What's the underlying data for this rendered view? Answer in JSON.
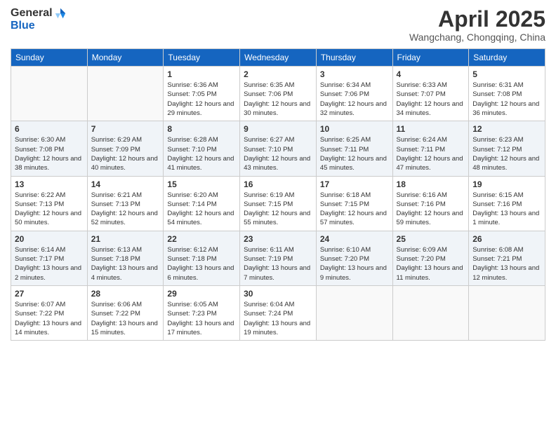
{
  "logo": {
    "general": "General",
    "blue": "Blue"
  },
  "title": "April 2025",
  "location": "Wangchang, Chongqing, China",
  "days_of_week": [
    "Sunday",
    "Monday",
    "Tuesday",
    "Wednesday",
    "Thursday",
    "Friday",
    "Saturday"
  ],
  "weeks": [
    [
      {
        "day": "",
        "sunrise": "",
        "sunset": "",
        "daylight": ""
      },
      {
        "day": "",
        "sunrise": "",
        "sunset": "",
        "daylight": ""
      },
      {
        "day": "1",
        "sunrise": "Sunrise: 6:36 AM",
        "sunset": "Sunset: 7:05 PM",
        "daylight": "Daylight: 12 hours and 29 minutes."
      },
      {
        "day": "2",
        "sunrise": "Sunrise: 6:35 AM",
        "sunset": "Sunset: 7:06 PM",
        "daylight": "Daylight: 12 hours and 30 minutes."
      },
      {
        "day": "3",
        "sunrise": "Sunrise: 6:34 AM",
        "sunset": "Sunset: 7:06 PM",
        "daylight": "Daylight: 12 hours and 32 minutes."
      },
      {
        "day": "4",
        "sunrise": "Sunrise: 6:33 AM",
        "sunset": "Sunset: 7:07 PM",
        "daylight": "Daylight: 12 hours and 34 minutes."
      },
      {
        "day": "5",
        "sunrise": "Sunrise: 6:31 AM",
        "sunset": "Sunset: 7:08 PM",
        "daylight": "Daylight: 12 hours and 36 minutes."
      }
    ],
    [
      {
        "day": "6",
        "sunrise": "Sunrise: 6:30 AM",
        "sunset": "Sunset: 7:08 PM",
        "daylight": "Daylight: 12 hours and 38 minutes."
      },
      {
        "day": "7",
        "sunrise": "Sunrise: 6:29 AM",
        "sunset": "Sunset: 7:09 PM",
        "daylight": "Daylight: 12 hours and 40 minutes."
      },
      {
        "day": "8",
        "sunrise": "Sunrise: 6:28 AM",
        "sunset": "Sunset: 7:10 PM",
        "daylight": "Daylight: 12 hours and 41 minutes."
      },
      {
        "day": "9",
        "sunrise": "Sunrise: 6:27 AM",
        "sunset": "Sunset: 7:10 PM",
        "daylight": "Daylight: 12 hours and 43 minutes."
      },
      {
        "day": "10",
        "sunrise": "Sunrise: 6:25 AM",
        "sunset": "Sunset: 7:11 PM",
        "daylight": "Daylight: 12 hours and 45 minutes."
      },
      {
        "day": "11",
        "sunrise": "Sunrise: 6:24 AM",
        "sunset": "Sunset: 7:11 PM",
        "daylight": "Daylight: 12 hours and 47 minutes."
      },
      {
        "day": "12",
        "sunrise": "Sunrise: 6:23 AM",
        "sunset": "Sunset: 7:12 PM",
        "daylight": "Daylight: 12 hours and 48 minutes."
      }
    ],
    [
      {
        "day": "13",
        "sunrise": "Sunrise: 6:22 AM",
        "sunset": "Sunset: 7:13 PM",
        "daylight": "Daylight: 12 hours and 50 minutes."
      },
      {
        "day": "14",
        "sunrise": "Sunrise: 6:21 AM",
        "sunset": "Sunset: 7:13 PM",
        "daylight": "Daylight: 12 hours and 52 minutes."
      },
      {
        "day": "15",
        "sunrise": "Sunrise: 6:20 AM",
        "sunset": "Sunset: 7:14 PM",
        "daylight": "Daylight: 12 hours and 54 minutes."
      },
      {
        "day": "16",
        "sunrise": "Sunrise: 6:19 AM",
        "sunset": "Sunset: 7:15 PM",
        "daylight": "Daylight: 12 hours and 55 minutes."
      },
      {
        "day": "17",
        "sunrise": "Sunrise: 6:18 AM",
        "sunset": "Sunset: 7:15 PM",
        "daylight": "Daylight: 12 hours and 57 minutes."
      },
      {
        "day": "18",
        "sunrise": "Sunrise: 6:16 AM",
        "sunset": "Sunset: 7:16 PM",
        "daylight": "Daylight: 12 hours and 59 minutes."
      },
      {
        "day": "19",
        "sunrise": "Sunrise: 6:15 AM",
        "sunset": "Sunset: 7:16 PM",
        "daylight": "Daylight: 13 hours and 1 minute."
      }
    ],
    [
      {
        "day": "20",
        "sunrise": "Sunrise: 6:14 AM",
        "sunset": "Sunset: 7:17 PM",
        "daylight": "Daylight: 13 hours and 2 minutes."
      },
      {
        "day": "21",
        "sunrise": "Sunrise: 6:13 AM",
        "sunset": "Sunset: 7:18 PM",
        "daylight": "Daylight: 13 hours and 4 minutes."
      },
      {
        "day": "22",
        "sunrise": "Sunrise: 6:12 AM",
        "sunset": "Sunset: 7:18 PM",
        "daylight": "Daylight: 13 hours and 6 minutes."
      },
      {
        "day": "23",
        "sunrise": "Sunrise: 6:11 AM",
        "sunset": "Sunset: 7:19 PM",
        "daylight": "Daylight: 13 hours and 7 minutes."
      },
      {
        "day": "24",
        "sunrise": "Sunrise: 6:10 AM",
        "sunset": "Sunset: 7:20 PM",
        "daylight": "Daylight: 13 hours and 9 minutes."
      },
      {
        "day": "25",
        "sunrise": "Sunrise: 6:09 AM",
        "sunset": "Sunset: 7:20 PM",
        "daylight": "Daylight: 13 hours and 11 minutes."
      },
      {
        "day": "26",
        "sunrise": "Sunrise: 6:08 AM",
        "sunset": "Sunset: 7:21 PM",
        "daylight": "Daylight: 13 hours and 12 minutes."
      }
    ],
    [
      {
        "day": "27",
        "sunrise": "Sunrise: 6:07 AM",
        "sunset": "Sunset: 7:22 PM",
        "daylight": "Daylight: 13 hours and 14 minutes."
      },
      {
        "day": "28",
        "sunrise": "Sunrise: 6:06 AM",
        "sunset": "Sunset: 7:22 PM",
        "daylight": "Daylight: 13 hours and 15 minutes."
      },
      {
        "day": "29",
        "sunrise": "Sunrise: 6:05 AM",
        "sunset": "Sunset: 7:23 PM",
        "daylight": "Daylight: 13 hours and 17 minutes."
      },
      {
        "day": "30",
        "sunrise": "Sunrise: 6:04 AM",
        "sunset": "Sunset: 7:24 PM",
        "daylight": "Daylight: 13 hours and 19 minutes."
      },
      {
        "day": "",
        "sunrise": "",
        "sunset": "",
        "daylight": ""
      },
      {
        "day": "",
        "sunrise": "",
        "sunset": "",
        "daylight": ""
      },
      {
        "day": "",
        "sunrise": "",
        "sunset": "",
        "daylight": ""
      }
    ]
  ]
}
